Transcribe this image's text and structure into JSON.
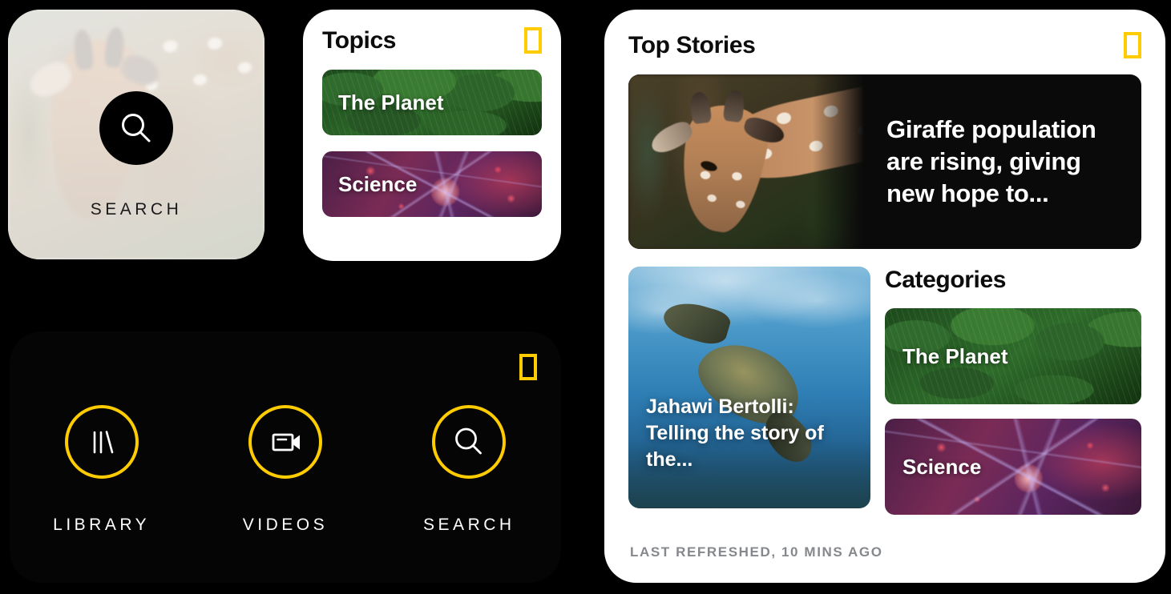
{
  "brand": {
    "logo_color": "#FFCC00",
    "logo_name": "national-geographic-logo"
  },
  "search_widget": {
    "button_icon": "search-icon",
    "label": "SEARCH"
  },
  "topics_widget": {
    "title": "Topics",
    "tiles": [
      {
        "label": "The Planet",
        "art": "green-leaves"
      },
      {
        "label": "Science",
        "art": "neuron"
      }
    ]
  },
  "dock_widget": {
    "items": [
      {
        "label": "LIBRARY",
        "icon": "library-icon"
      },
      {
        "label": "VIDEOS",
        "icon": "video-camera-icon"
      },
      {
        "label": "SEARCH",
        "icon": "search-icon"
      }
    ]
  },
  "stories_widget": {
    "title": "Top Stories",
    "hero": {
      "headline": "Giraffe population are rising, giving new hope to...",
      "image_subject": "giraffe"
    },
    "secondary": {
      "headline": "Jahawi Bertolli: Telling the story of the...",
      "image_subject": "sea-turtle"
    },
    "categories_title": "Categories",
    "categories": [
      {
        "label": "The Planet",
        "art": "green-leaves"
      },
      {
        "label": "Science",
        "art": "neuron"
      }
    ],
    "footer": "LAST REFRESHED, 10 MINS AGO"
  }
}
